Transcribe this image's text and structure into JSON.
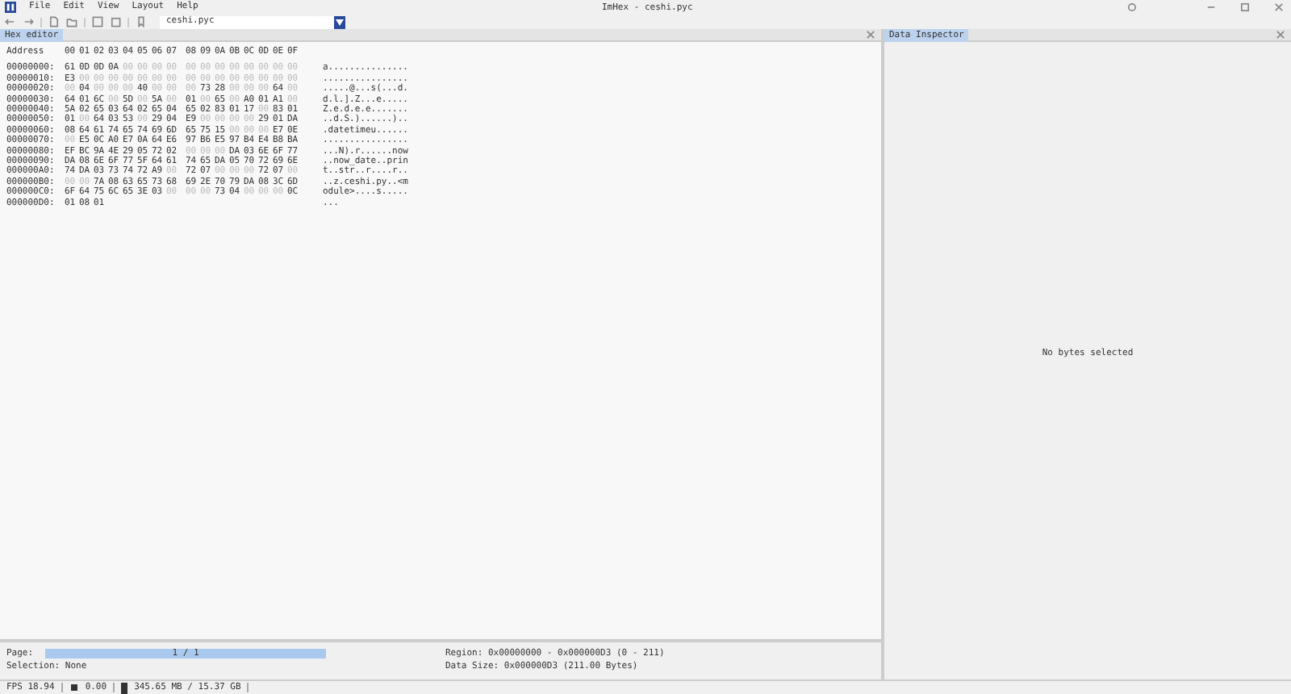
{
  "window": {
    "title": "ImHex - ceshi.pyc"
  },
  "menu": [
    "File",
    "Edit",
    "View",
    "Layout",
    "Help"
  ],
  "toolbar": {
    "file_selector": "ceshi.pyc"
  },
  "hex_editor": {
    "tab": "Hex editor",
    "address_header": "Address",
    "column_headers": [
      "00",
      "01",
      "02",
      "03",
      "04",
      "05",
      "06",
      "07",
      "08",
      "09",
      "0A",
      "0B",
      "0C",
      "0D",
      "0E",
      "0F"
    ],
    "rows": [
      {
        "address": "00000000:",
        "bytes": [
          "61",
          "0D",
          "0D",
          "0A",
          "00",
          "00",
          "00",
          "00",
          "00",
          "00",
          "00",
          "00",
          "00",
          "00",
          "00",
          "00"
        ],
        "ascii": "a..............."
      },
      {
        "address": "00000010:",
        "bytes": [
          "E3",
          "00",
          "00",
          "00",
          "00",
          "00",
          "00",
          "00",
          "00",
          "00",
          "00",
          "00",
          "00",
          "00",
          "00",
          "00"
        ],
        "ascii": "................"
      },
      {
        "address": "00000020:",
        "bytes": [
          "00",
          "04",
          "00",
          "00",
          "00",
          "40",
          "00",
          "00",
          "00",
          "73",
          "28",
          "00",
          "00",
          "00",
          "64",
          "00"
        ],
        "ascii": ".....@...s(...d."
      },
      {
        "address": "00000030:",
        "bytes": [
          "64",
          "01",
          "6C",
          "00",
          "5D",
          "00",
          "5A",
          "00",
          "01",
          "00",
          "65",
          "00",
          "A0",
          "01",
          "A1",
          "00"
        ],
        "ascii": "d.l.].Z...e....."
      },
      {
        "address": "00000040:",
        "bytes": [
          "5A",
          "02",
          "65",
          "03",
          "64",
          "02",
          "65",
          "04",
          "65",
          "02",
          "83",
          "01",
          "17",
          "00",
          "83",
          "01"
        ],
        "ascii": "Z.e.d.e.e......."
      },
      {
        "address": "00000050:",
        "bytes": [
          "01",
          "00",
          "64",
          "03",
          "53",
          "00",
          "29",
          "04",
          "E9",
          "00",
          "00",
          "00",
          "00",
          "29",
          "01",
          "DA"
        ],
        "ascii": "..d.S.)......).."
      },
      {
        "address": "00000060:",
        "bytes": [
          "08",
          "64",
          "61",
          "74",
          "65",
          "74",
          "69",
          "6D",
          "65",
          "75",
          "15",
          "00",
          "00",
          "00",
          "E7",
          "0E"
        ],
        "ascii": ".datetimeu......"
      },
      {
        "address": "00000070:",
        "bytes": [
          "00",
          "E5",
          "0C",
          "A0",
          "E7",
          "0A",
          "64",
          "E6",
          "97",
          "B6",
          "E5",
          "97",
          "B4",
          "E4",
          "B8",
          "BA"
        ],
        "ascii": "................"
      },
      {
        "address": "00000080:",
        "bytes": [
          "EF",
          "BC",
          "9A",
          "4E",
          "29",
          "05",
          "72",
          "02",
          "00",
          "00",
          "00",
          "DA",
          "03",
          "6E",
          "6F",
          "77"
        ],
        "ascii": "...N).r......now"
      },
      {
        "address": "00000090:",
        "bytes": [
          "DA",
          "08",
          "6E",
          "6F",
          "77",
          "5F",
          "64",
          "61",
          "74",
          "65",
          "DA",
          "05",
          "70",
          "72",
          "69",
          "6E"
        ],
        "ascii": "..now_date..prin"
      },
      {
        "address": "000000A0:",
        "bytes": [
          "74",
          "DA",
          "03",
          "73",
          "74",
          "72",
          "A9",
          "00",
          "72",
          "07",
          "00",
          "00",
          "00",
          "72",
          "07",
          "00"
        ],
        "ascii": "t..str..r....r.."
      },
      {
        "address": "000000B0:",
        "bytes": [
          "00",
          "00",
          "7A",
          "08",
          "63",
          "65",
          "73",
          "68",
          "69",
          "2E",
          "70",
          "79",
          "DA",
          "08",
          "3C",
          "6D"
        ],
        "ascii": "..z.ceshi.py..<m"
      },
      {
        "address": "000000C0:",
        "bytes": [
          "6F",
          "64",
          "75",
          "6C",
          "65",
          "3E",
          "03",
          "00",
          "00",
          "00",
          "73",
          "04",
          "00",
          "00",
          "00",
          "0C"
        ],
        "ascii": "odule>....s....."
      },
      {
        "address": "000000D0:",
        "bytes": [
          "01",
          "08",
          "01"
        ],
        "ascii": "..."
      }
    ],
    "page_label": "Page:",
    "page": {
      "text": "1 / 1",
      "level": 1
    },
    "selection": "Selection: None",
    "region": "Region: 0x00000000 - 0x000000D3 (0 - 211)",
    "data_size": "Data Size: 0x000000D3 (211.00 Bytes)"
  },
  "data_inspector": {
    "tab": "Data Inspector",
    "message": "No bytes selected"
  },
  "status_bar": {
    "fps": "FPS 18.94",
    "cpu": "0.00",
    "memory": "345.65 MB / 15.37 GB"
  }
}
